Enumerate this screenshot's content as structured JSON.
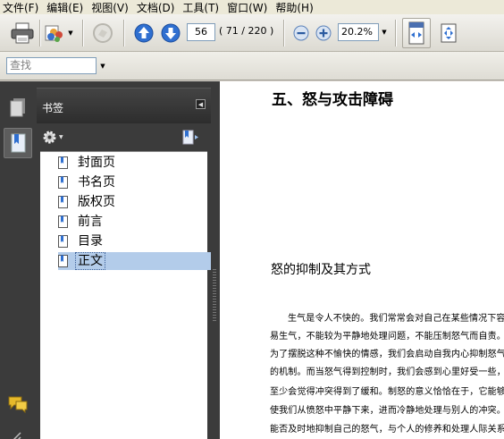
{
  "menubar": {
    "items": [
      "文件(F)",
      "编辑(E)",
      "视图(V)",
      "文档(D)",
      "工具(T)",
      "窗口(W)",
      "帮助(H)"
    ]
  },
  "toolbar": {
    "current_page": "56",
    "page_total": "( 71 / 220 )",
    "zoom": "20.2%"
  },
  "findbar": {
    "placeholder": "查找"
  },
  "bookmarks": {
    "title": "书签",
    "items": [
      "封面页",
      "书名页",
      "版权页",
      "前言",
      "目录",
      "正文"
    ],
    "selected_index": 5
  },
  "document": {
    "heading": "五、怒与攻击障碍",
    "subheading": "怒的抑制及其方式",
    "lines": [
      "生气是令人不快的。我们常常会对自己在某些情况下容",
      "易生气，不能较为平静地处理问题，不能压制怒气而自责。",
      "为了摆脱这种不愉快的情感，我们会启动自我内心抑制怒气",
      "的机制。而当怒气得到控制时，我们会感到心里好受一些，",
      "至少会觉得冲突得到了缓和。制怒的意义恰恰在于，它能够",
      "使我们从愤怒中平静下来，进而冷静地处理与别人的冲突。",
      "能否及时地抑制自己的怒气，与个人的修养和处理人际关系"
    ]
  },
  "colors": {
    "panel_bg": "#3b3b3b",
    "selection": "#b3ccea",
    "arrow_blue": "#2f6fd0"
  }
}
